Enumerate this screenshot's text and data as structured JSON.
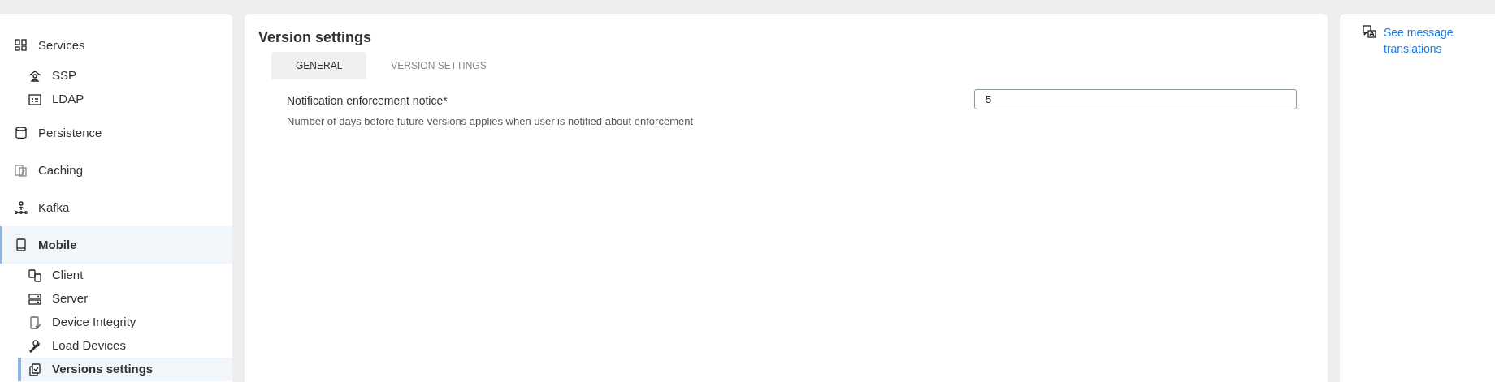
{
  "sidebar": {
    "items": [
      {
        "label": "Services",
        "selected": false,
        "children": [
          {
            "label": "SSP",
            "selected": false
          },
          {
            "label": "LDAP",
            "selected": false
          }
        ]
      },
      {
        "label": "Persistence",
        "selected": false
      },
      {
        "label": "Caching",
        "selected": false
      },
      {
        "label": "Kafka",
        "selected": false
      },
      {
        "label": "Mobile",
        "selected": true,
        "children": [
          {
            "label": "Client",
            "selected": false
          },
          {
            "label": "Server",
            "selected": false
          },
          {
            "label": "Device Integrity",
            "selected": false
          },
          {
            "label": "Load Devices",
            "selected": false
          },
          {
            "label": "Versions settings",
            "selected": true
          }
        ]
      }
    ]
  },
  "main": {
    "title": "Version settings",
    "tabs": [
      {
        "label": "GENERAL",
        "selected": true
      },
      {
        "label": "VERSION SETTINGS",
        "selected": false
      }
    ],
    "fields": [
      {
        "label": "Notification enforcement notice*",
        "description": "Number of days before future versions applies when user is notified about enforcement",
        "value": "5"
      }
    ]
  },
  "aside": {
    "link": "See message translations"
  }
}
